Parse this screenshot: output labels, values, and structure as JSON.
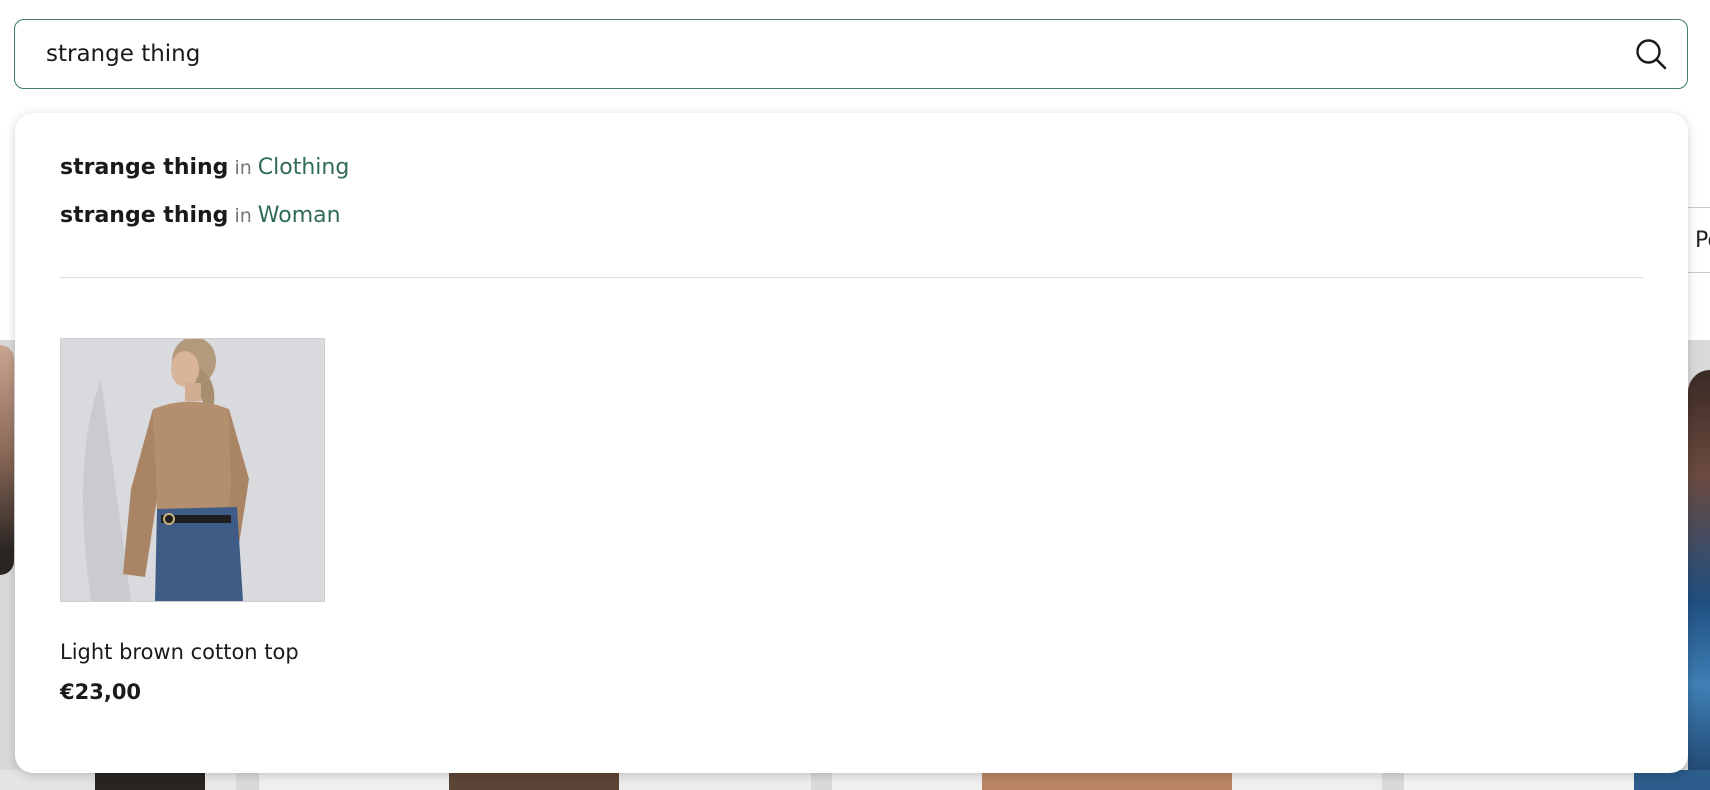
{
  "search": {
    "value": "strange thing",
    "submit_icon": "search-icon"
  },
  "background": {
    "sort_select_partial": "Popul"
  },
  "dropdown": {
    "suggestions": [
      {
        "term": "strange thing",
        "connector": "in",
        "category": "Clothing"
      },
      {
        "term": "strange thing",
        "connector": "in",
        "category": "Woman"
      }
    ],
    "products": [
      {
        "name": "Light brown cotton top",
        "price": "€23,00"
      }
    ]
  },
  "colors": {
    "accent": "#2f6b58",
    "search_border": "#3f7b6a"
  }
}
